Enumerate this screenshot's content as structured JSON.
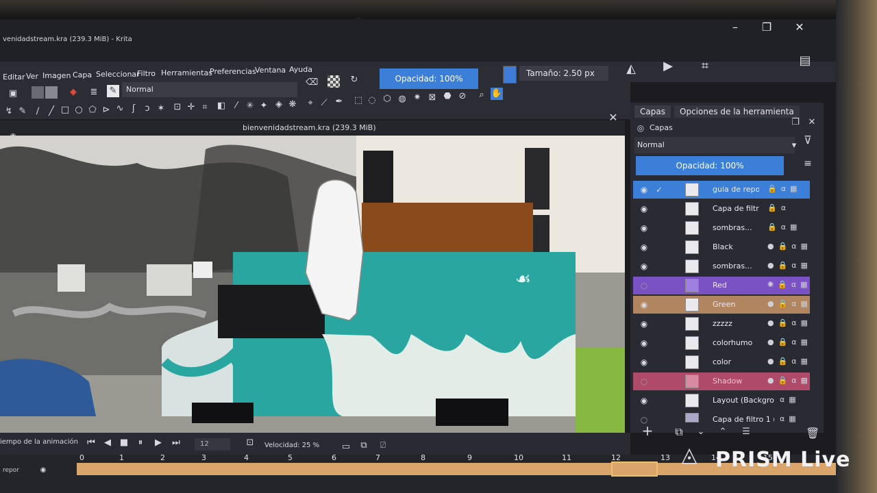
{
  "window": {
    "title": "venidadstream.kra (239.3 MiB) - Krita"
  },
  "menu": [
    "Editar",
    "Ver",
    "Imagen",
    "Capa",
    "Seleccionar",
    "Filtro",
    "Herramientas",
    "Preferencias",
    "Ventana",
    "Ayuda"
  ],
  "toolbar": {
    "blend_mode": "Normal",
    "opacity_label": "Opacidad: 100%",
    "size_label": "Tamaño: 2.50 px"
  },
  "document": {
    "tab_title": "bienvenidadstream.kra (239.3 MiB)"
  },
  "dock": {
    "tab_layers": "Capas",
    "tab_tool_options": "Opciones de la herramienta",
    "panel_title": "Capas",
    "blend_mode": "Normal",
    "opacity_label": "Opacidad:  100%",
    "layers": [
      {
        "name": "guia de repor",
        "color": "#3d7bd6"
      },
      {
        "name": "Capa de filtr...",
        "color": ""
      },
      {
        "name": "sombras...",
        "color": ""
      },
      {
        "name": "Black",
        "color": ""
      },
      {
        "name": "sombras...",
        "color": ""
      },
      {
        "name": "Red",
        "color": "#7b52c4"
      },
      {
        "name": "Green",
        "color": "#b08560"
      },
      {
        "name": "zzzzz",
        "color": ""
      },
      {
        "name": "colorhumo",
        "color": ""
      },
      {
        "name": "color",
        "color": ""
      },
      {
        "name": "Shadow",
        "color": "#b04a6a"
      },
      {
        "name": "Layout (Backgro...",
        "color": ""
      },
      {
        "name": "Capa de filtro 1 (...",
        "color": ""
      }
    ]
  },
  "animation": {
    "label": "iempo de la animación",
    "frame_value": "12",
    "speed_label": "Velocidad: 25 %",
    "layer_name": "repor",
    "frames": [
      "0",
      "1",
      "2",
      "3",
      "4",
      "5",
      "6",
      "7",
      "8",
      "9",
      "10",
      "11",
      "12",
      "13",
      "14",
      "15"
    ]
  },
  "watermark": "PRISM Live"
}
